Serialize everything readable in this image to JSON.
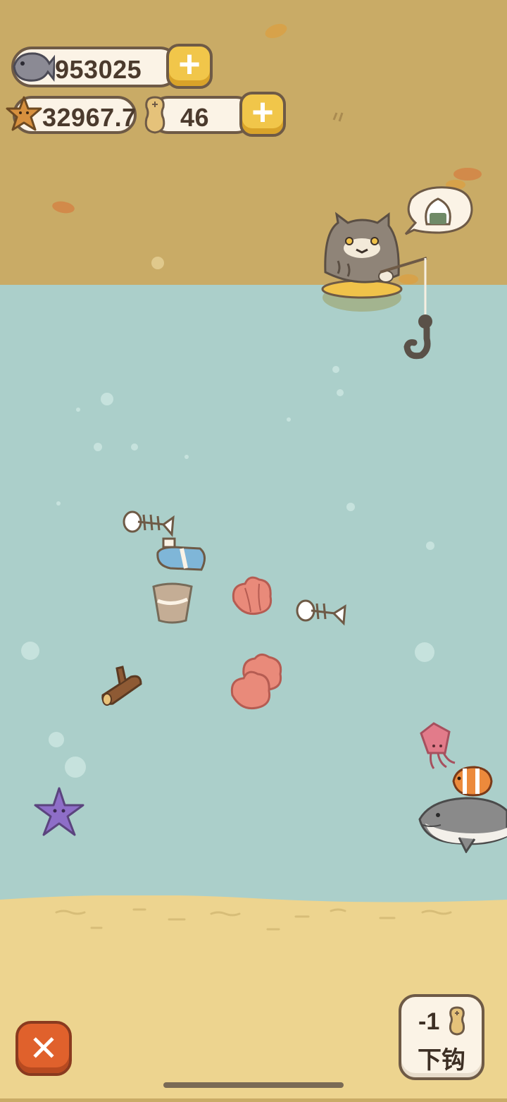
{
  "currencies": {
    "fish": {
      "value": "953025",
      "icon": "fish-icon"
    },
    "stars": {
      "value": "32967.7",
      "icon": "starfish-icon"
    },
    "bait": {
      "value": "46",
      "icon": "peanut-icon"
    }
  },
  "buttons": {
    "plus_label": "+",
    "close_label": "✕",
    "drop_hook": {
      "cost": "-1",
      "label": "下钩",
      "cost_icon": "peanut-icon"
    }
  },
  "thought_bubble": {
    "icon": "onigiri-icon"
  },
  "colors": {
    "shore": "#c9ab66",
    "water": "#abcfca",
    "seabed": "#edd48f",
    "accent": "#f1c64a",
    "close": "#e0612c"
  }
}
